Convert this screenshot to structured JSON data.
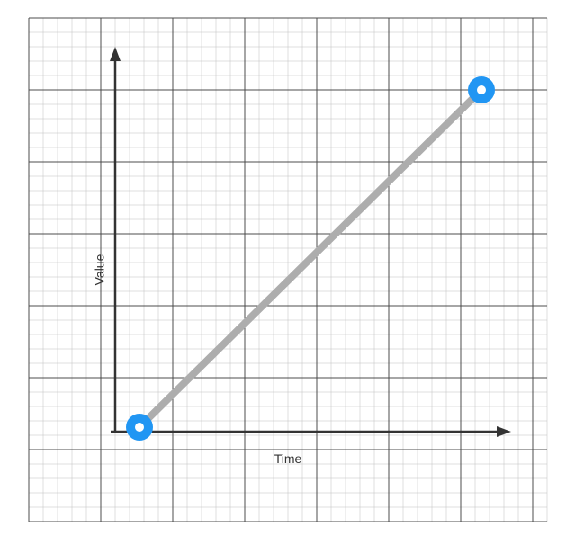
{
  "chart_data": {
    "type": "line",
    "title": "",
    "xlabel": "Time",
    "ylabel": "Value",
    "points": [
      {
        "x": 0,
        "y": 0
      },
      {
        "x": 1,
        "y": 1
      }
    ],
    "xlim": [
      0,
      1
    ],
    "ylim": [
      0,
      1
    ]
  },
  "colors": {
    "grid_minor": "#666666",
    "grid_major": "#222222",
    "axis": "#333333",
    "line": "#adadad",
    "marker_fill": "#2196f3",
    "marker_inner": "#ffffff"
  }
}
